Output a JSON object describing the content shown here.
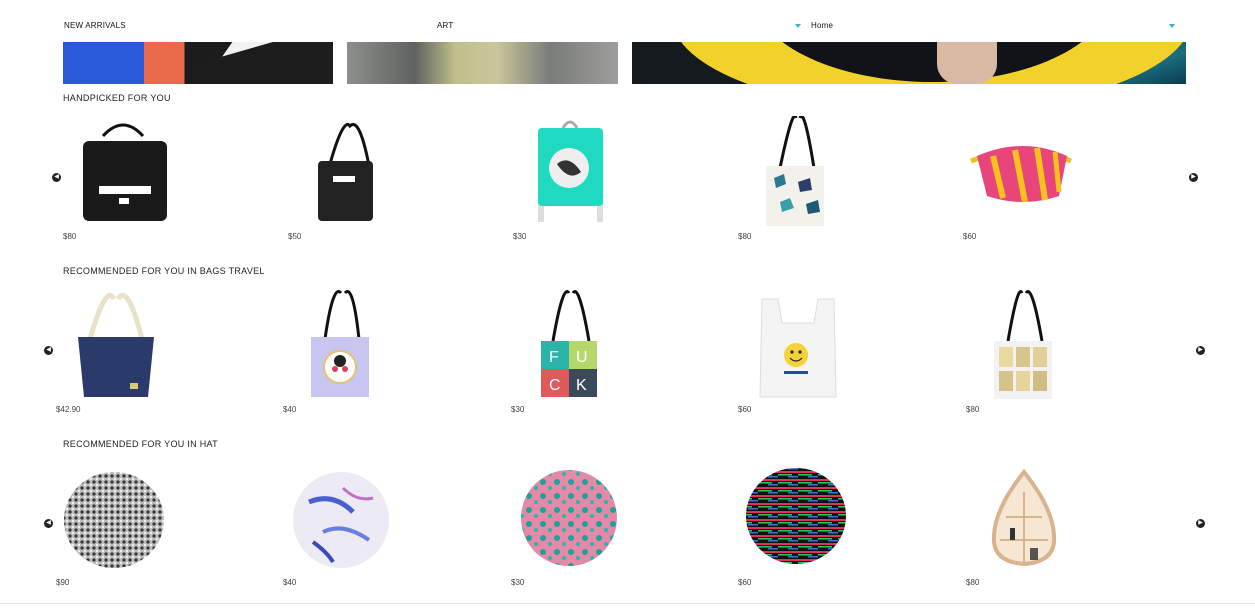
{
  "nav": {
    "new_arrivals": "NEW ARRIVALS",
    "art_select": "ART",
    "home_select": "Home",
    "accent_color": "#3ab0d6"
  },
  "sections": [
    {
      "title": "HANDPICKED FOR YOU",
      "products": [
        {
          "name": "black-foldable-duffel-bag",
          "price": "$80"
        },
        {
          "name": "black-foldable-tote-bag",
          "price": "$50"
        },
        {
          "name": "turquoise-backpack",
          "price": "$30"
        },
        {
          "name": "crystal-print-tote-bag",
          "price": "$80"
        },
        {
          "name": "striped-fanny-pack",
          "price": "$60"
        }
      ]
    },
    {
      "title": "RECOMMENDED FOR YOU IN BAGS TRAVEL",
      "products": [
        {
          "name": "navy-rope-handle-tote",
          "price": "$42.90"
        },
        {
          "name": "lilac-portrait-tote",
          "price": "$40"
        },
        {
          "name": "color-block-letter-tote",
          "price": "$30"
        },
        {
          "name": "smiley-plastic-bag-tote",
          "price": "$60"
        },
        {
          "name": "tarot-cards-tote",
          "price": "$80"
        }
      ]
    },
    {
      "title": "RECOMMENDED FOR YOU IN HAT",
      "products": [
        {
          "name": "bw-pattern-beanbag",
          "price": "$90"
        },
        {
          "name": "blue-splash-beanbag",
          "price": "$40"
        },
        {
          "name": "pink-teal-beanbag",
          "price": "$30"
        },
        {
          "name": "glitch-stripe-beanbag",
          "price": "$60"
        },
        {
          "name": "teardrop-wall-shelf",
          "price": "$80"
        }
      ]
    }
  ],
  "arrows": {
    "prev": "‹",
    "next": "›"
  }
}
